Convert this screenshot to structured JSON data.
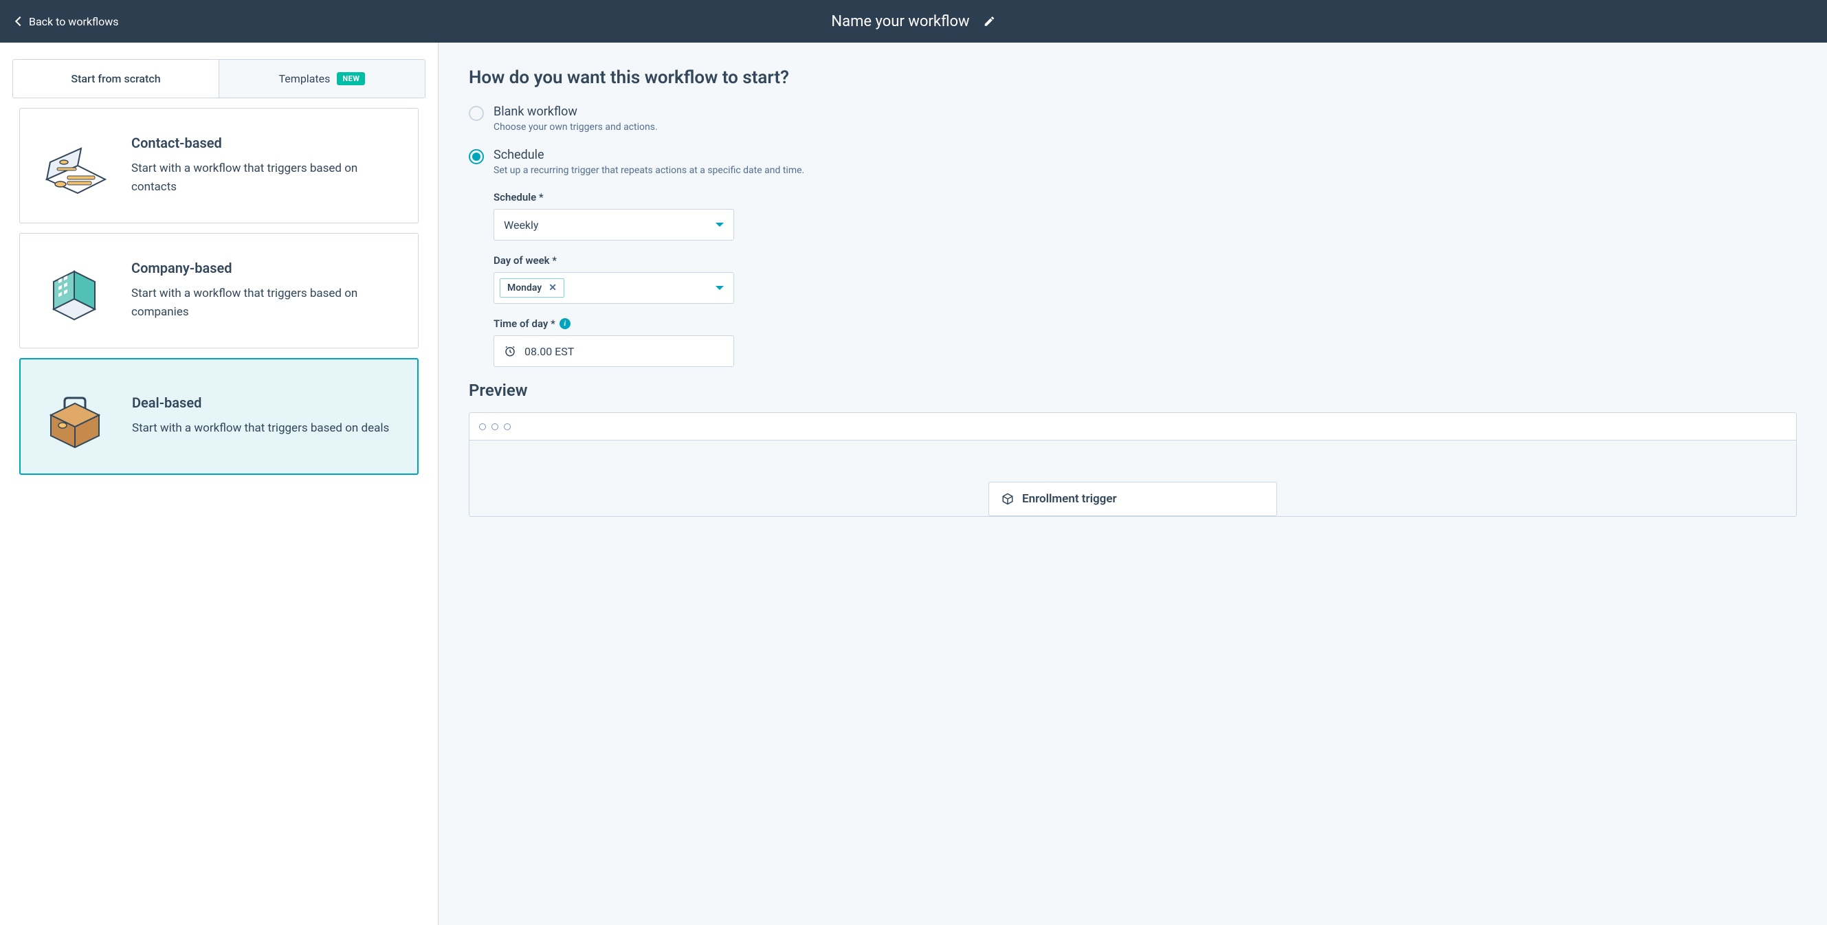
{
  "header": {
    "back_label": "Back to workflows",
    "title": "Name your workflow"
  },
  "tabs": {
    "scratch": "Start from scratch",
    "templates": "Templates",
    "badge": "NEW"
  },
  "cards": [
    {
      "title": "Contact-based",
      "desc": "Start with a workflow that triggers based on contacts"
    },
    {
      "title": "Company-based",
      "desc": "Start with a workflow that triggers based on companies"
    },
    {
      "title": "Deal-based",
      "desc": "Start with a workflow that triggers based on deals"
    }
  ],
  "right": {
    "heading": "How do you want this workflow to start?",
    "options": {
      "blank": {
        "title": "Blank workflow",
        "desc": "Choose your own triggers and actions."
      },
      "schedule": {
        "title": "Schedule",
        "desc": "Set up a recurring trigger that repeats actions at a specific date and time."
      }
    },
    "fields": {
      "schedule_label": "Schedule *",
      "schedule_value": "Weekly",
      "dow_label": "Day of week *",
      "dow_chip": "Monday",
      "tod_label": "Time of day *",
      "tod_value": "08.00 EST"
    },
    "preview_heading": "Preview",
    "trigger_label": "Enrollment trigger"
  }
}
